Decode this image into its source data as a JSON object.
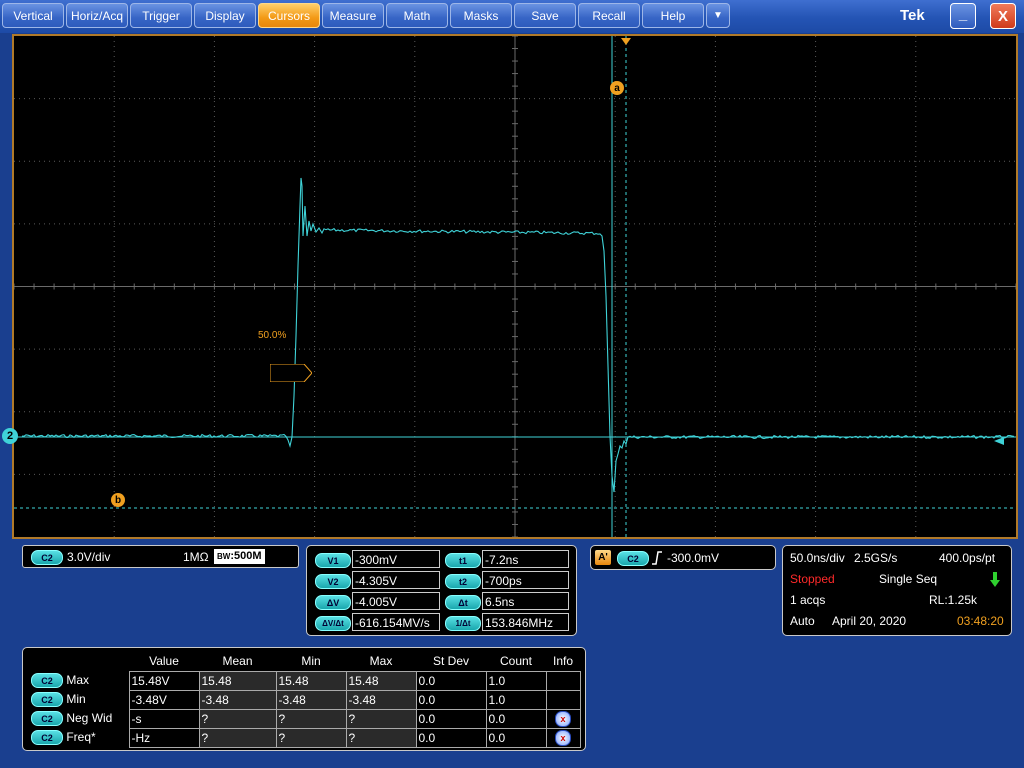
{
  "menu": {
    "items": [
      "Vertical",
      "Horiz/Acq",
      "Trigger",
      "Display",
      "Cursors",
      "Measure",
      "Math",
      "Masks",
      "Save",
      "Recall",
      "Help"
    ],
    "dropdown": "▼",
    "active": "Cursors",
    "brand": "Tek",
    "minimize": "_",
    "close": "X"
  },
  "display": {
    "ref_level_label": "50.0%",
    "cursor_a_label": "a",
    "cursor_b_label": "b",
    "channel_marker": "2"
  },
  "channel": {
    "badge": "C2",
    "scale": "3.0V/div",
    "impedance": "1MΩ",
    "bw_label": "BW",
    "bandwidth": ":500M"
  },
  "cursors": {
    "v1_label": "V1",
    "v1": "-300mV",
    "v2_label": "V2",
    "v2": "-4.305V",
    "dv_label": "ΔV",
    "dv": "-4.005V",
    "dvdt_label": "ΔV/Δt",
    "dvdt": "-616.154MV/s",
    "t1_label": "t1",
    "t1": "-7.2ns",
    "t2_label": "t2",
    "t2": "-700ps",
    "dt_label": "Δt",
    "dt": "6.5ns",
    "invdt_label": "1/Δt",
    "invdt": "153.846MHz"
  },
  "trigger": {
    "mode_badge": "A'",
    "source": "C2",
    "level": "-300.0mV"
  },
  "acquisition": {
    "timebase": "50.0ns/div",
    "sample_rate": "2.5GS/s",
    "resolution": "400.0ps/pt",
    "state": "Stopped",
    "seq": "Single Seq",
    "acqs": "1 acqs",
    "record_length": "RL:1.25k",
    "mode": "Auto",
    "date": "April 20, 2020",
    "time": "03:48:20"
  },
  "measurements": {
    "headers": [
      "Value",
      "Mean",
      "Min",
      "Max",
      "St Dev",
      "Count",
      "Info"
    ],
    "rows": [
      {
        "badge": "C2",
        "name": "Max",
        "value": "15.48V",
        "mean": "15.48",
        "min": "15.48",
        "max": "15.48",
        "stdev": "0.0",
        "count": "1.0",
        "info": ""
      },
      {
        "badge": "C2",
        "name": "Min",
        "value": "-3.48V",
        "mean": "-3.48",
        "min": "-3.48",
        "max": "-3.48",
        "stdev": "0.0",
        "count": "1.0",
        "info": ""
      },
      {
        "badge": "C2",
        "name": "Neg Wid",
        "value": "-s",
        "mean": "?",
        "min": "?",
        "max": "?",
        "stdev": "0.0",
        "count": "0.0",
        "info": "x"
      },
      {
        "badge": "C2",
        "name": "Freq*",
        "value": "-Hz",
        "mean": "?",
        "min": "?",
        "max": "?",
        "stdev": "0.0",
        "count": "0.0",
        "info": "x"
      }
    ]
  },
  "colors": {
    "trace": "#3fd3d8",
    "cursor": "#3fd3d8",
    "accent": "#f39a16",
    "stopped": "#ff2a2a",
    "time": "#f0a020"
  }
}
